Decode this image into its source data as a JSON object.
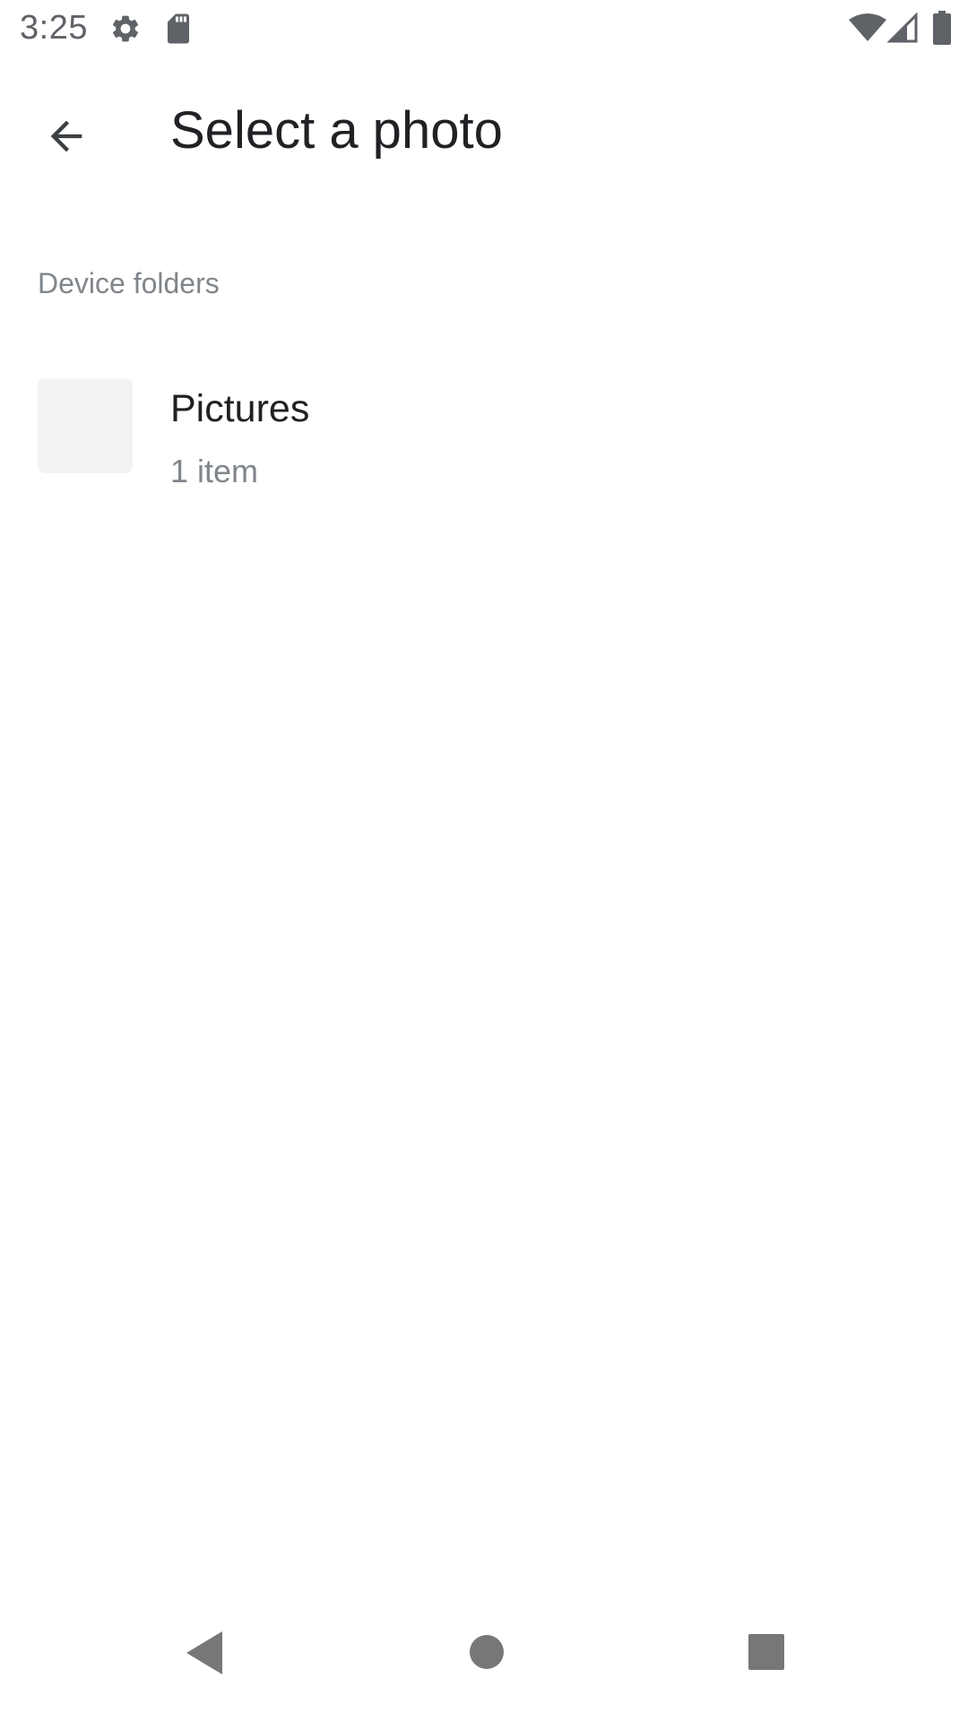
{
  "status_bar": {
    "time": "3:25",
    "icons": [
      "gear-icon",
      "sd-card-icon",
      "wifi-icon",
      "signal-icon",
      "battery-icon"
    ]
  },
  "app_bar": {
    "title": "Select a photo",
    "back_icon": "arrow-back-icon"
  },
  "sections": [
    {
      "header": "Device folders",
      "folders": [
        {
          "name": "Pictures",
          "count": "1 item"
        }
      ]
    }
  ],
  "nav_bar": {
    "icons": [
      "nav-back-icon",
      "nav-home-icon",
      "nav-recents-icon"
    ]
  },
  "colors": {
    "title_text": "#202124",
    "secondary_text": "#80868b",
    "icon": "#5f6368",
    "thumbnail_bg": "#f1f3f4"
  }
}
